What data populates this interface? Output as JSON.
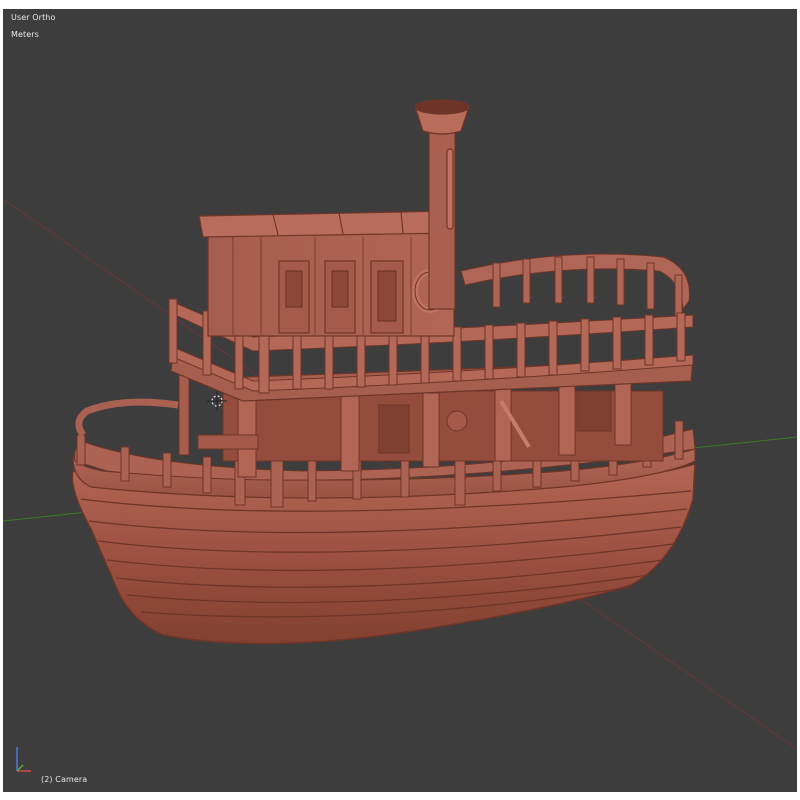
{
  "viewport": {
    "view_name": "User Ortho",
    "units": "Meters",
    "camera_label": "(2) Camera",
    "background_color": "#3d3d3d"
  },
  "scene": {
    "object": "steamboat-model",
    "material_color": "#a85a4a",
    "x_axis_color": "#7a3a3a",
    "y_axis_color": "#3f7a2f"
  },
  "icons": [
    "axis-gizmo-icon",
    "3d-cursor-icon"
  ]
}
